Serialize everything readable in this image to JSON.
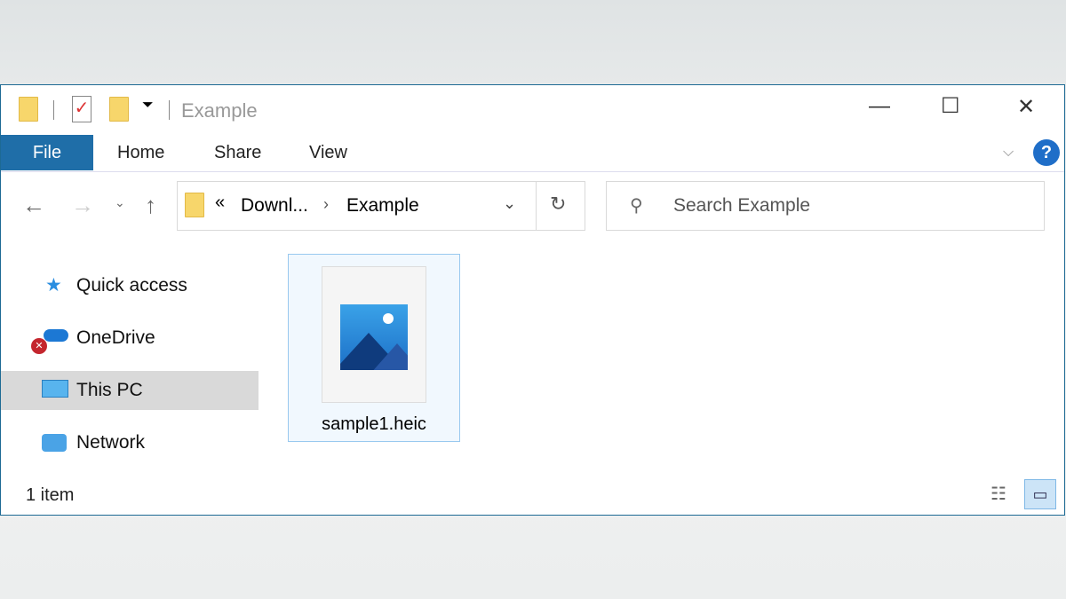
{
  "window": {
    "title": "Example",
    "minimize": "—",
    "maximize": "☐",
    "close": "✕"
  },
  "ribbon": {
    "tabs": [
      "File",
      "Home",
      "Share",
      "View"
    ],
    "help": "?"
  },
  "address": {
    "prefix": "«",
    "crumbs": [
      "Downl...",
      "Example"
    ]
  },
  "search": {
    "placeholder": "Search Example"
  },
  "sidebar": {
    "items": [
      {
        "label": "Quick access"
      },
      {
        "label": "OneDrive"
      },
      {
        "label": "This PC",
        "selected": true
      },
      {
        "label": "Network"
      }
    ]
  },
  "files": [
    {
      "name": "sample1.heic"
    }
  ],
  "status": {
    "count": "1 item"
  }
}
